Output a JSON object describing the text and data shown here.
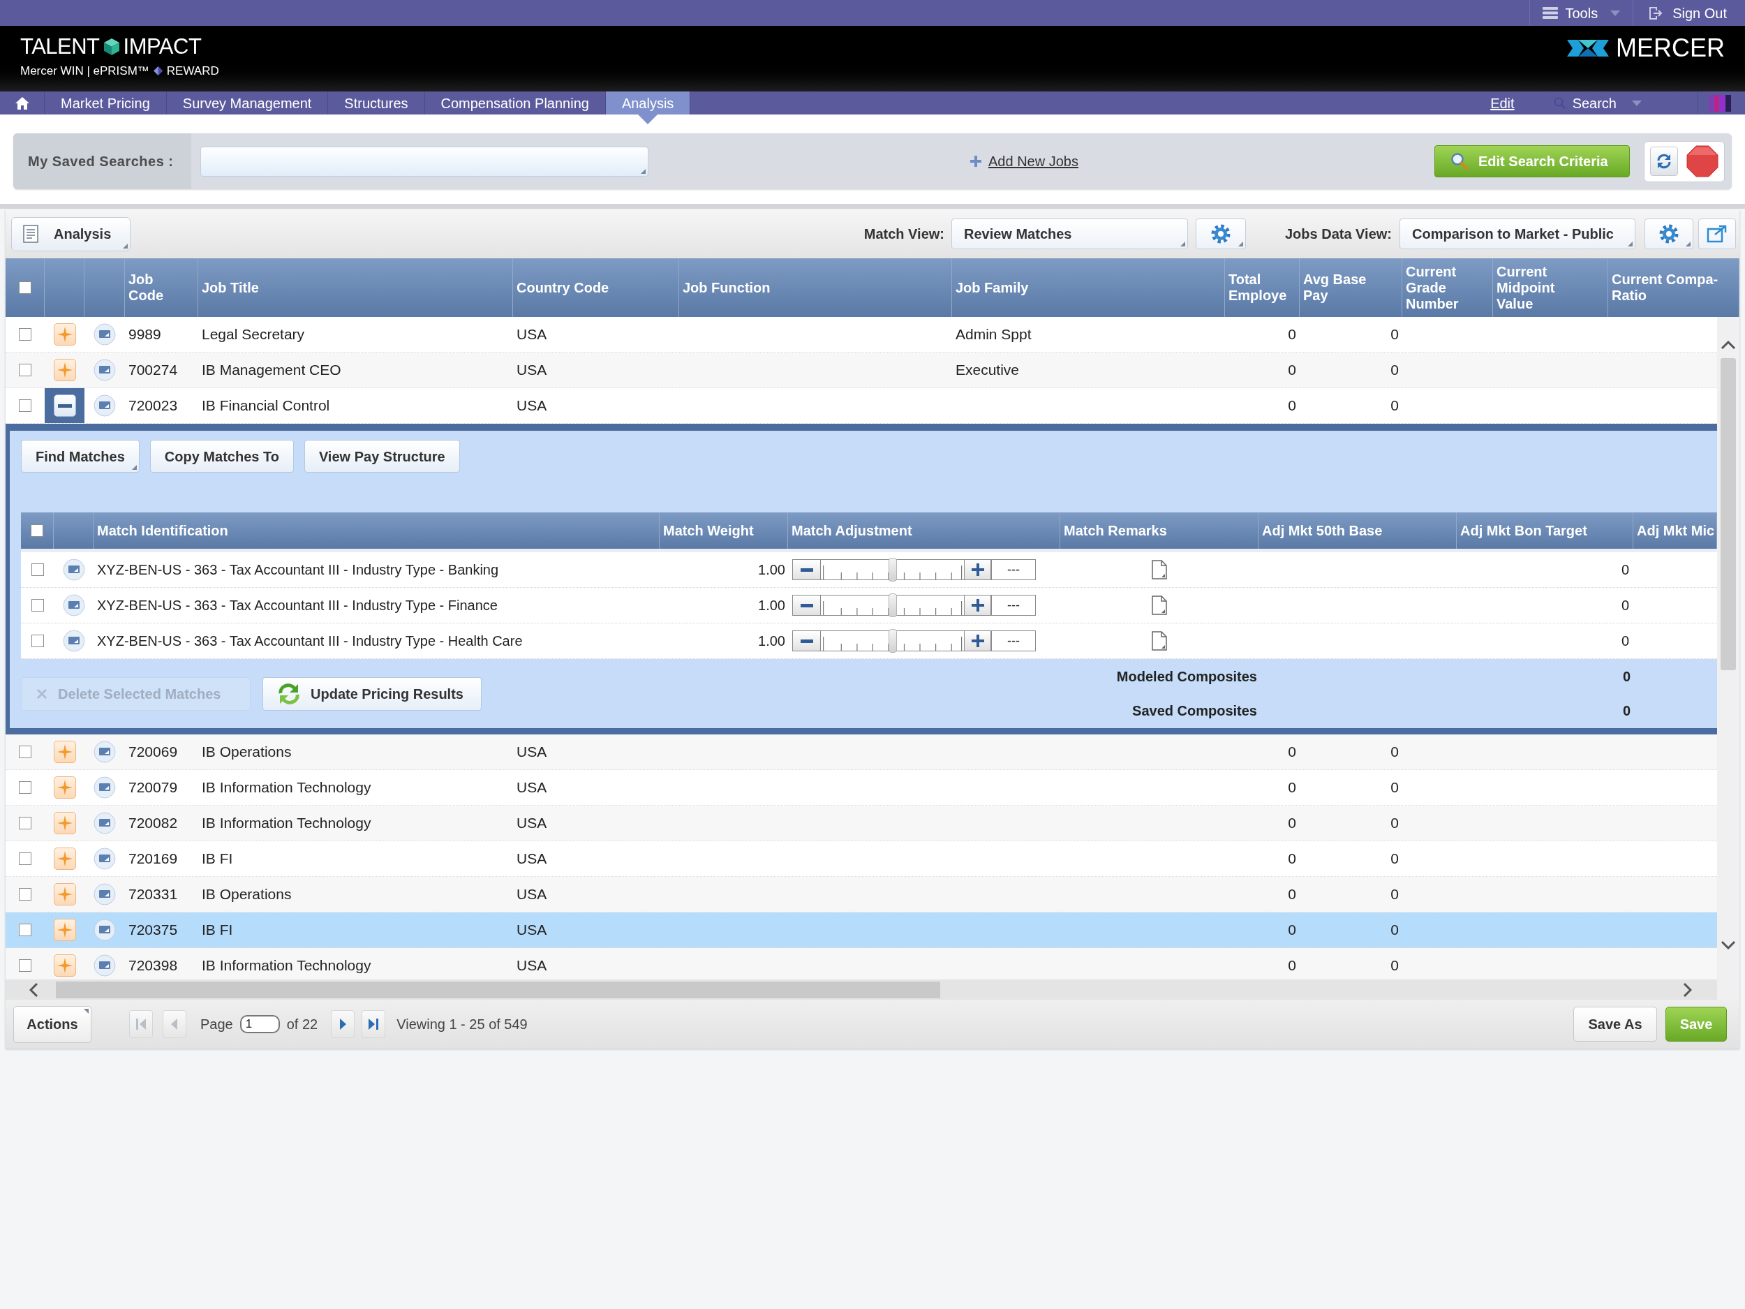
{
  "top_bar": {
    "tools": "Tools",
    "sign_out": "Sign Out"
  },
  "header": {
    "product": [
      "TALENT",
      "IMPACT"
    ],
    "modules": [
      "Mercer WIN | ePRISM™",
      "REWARD"
    ],
    "brand": "MERCER"
  },
  "nav": {
    "tabs": [
      {
        "label": "Market Pricing",
        "selected": false
      },
      {
        "label": "Survey Management",
        "selected": false
      },
      {
        "label": "Structures",
        "selected": false
      },
      {
        "label": "Compensation Planning",
        "selected": false
      },
      {
        "label": "Analysis",
        "selected": true
      }
    ],
    "edit": "Edit",
    "search": "Search"
  },
  "saved_searches": {
    "label": "My Saved Searches :",
    "add_new_jobs": "Add New Jobs",
    "edit_search_criteria": "Edit Search Criteria"
  },
  "toolbar": {
    "analysis": "Analysis",
    "match_view": {
      "label": "Match View:",
      "value": "Review Matches"
    },
    "jobs_data_view": {
      "label": "Jobs Data View:",
      "value": "Comparison to Market - Public"
    }
  },
  "jobs_table": {
    "all_checked": false,
    "columns": [
      "Job Code",
      "Job Title",
      "Country Code",
      "Job Function",
      "Job Family",
      "Total Employe",
      "Avg Base Pay",
      "Current Grade Number",
      "Current Midpoint Value",
      "Current Compa-Ratio"
    ],
    "rows": [
      {
        "checked": false,
        "expanded": false,
        "selected": false,
        "job_code": "9989",
        "job_title": "Legal Secretary",
        "country_code": "USA",
        "job_family": "Admin Sppt",
        "total_employees": "0",
        "avg_base_pay": "0"
      },
      {
        "checked": false,
        "expanded": false,
        "selected": false,
        "job_code": "700274",
        "job_title": "IB Management CEO",
        "country_code": "USA",
        "job_family": "Executive",
        "total_employees": "0",
        "avg_base_pay": "0"
      },
      {
        "checked": false,
        "expanded": true,
        "selected": false,
        "job_code": "720023",
        "job_title": "IB Financial Control",
        "country_code": "USA",
        "total_employees": "0",
        "avg_base_pay": "0",
        "detail": {
          "buttons": [
            "Find Matches",
            "Copy Matches To",
            "View Pay Structure"
          ],
          "all_checked": false,
          "columns": [
            "Match Identification",
            "Match Weight",
            "Match Adjustment",
            "Match Remarks",
            "Adj Mkt 50th Base",
            "Adj Mkt Bon Target",
            "Adj Mkt Mic"
          ],
          "matches": [
            {
              "checked": false,
              "identification": "XYZ-BEN-US - 363 - Tax Accountant III - Industry Type - Banking",
              "weight": "1.00",
              "adjustment": {
                "level": 0.5,
                "value": "---"
              },
              "adj_mkt_bon_target": "0"
            },
            {
              "checked": false,
              "identification": "XYZ-BEN-US - 363 - Tax Accountant III - Industry Type - Finance",
              "weight": "1.00",
              "adjustment": {
                "level": 0.5,
                "value": "---"
              },
              "adj_mkt_bon_target": "0"
            },
            {
              "checked": false,
              "identification": "XYZ-BEN-US - 363 - Tax Accountant III - Industry Type - Health Care",
              "weight": "1.00",
              "adjustment": {
                "level": 0.5,
                "value": "---"
              },
              "adj_mkt_bon_target": "0"
            }
          ],
          "delete_button": {
            "label": "Delete Selected Matches",
            "disabled": true
          },
          "update_button": "Update Pricing Results",
          "summary": [
            {
              "label": "Modeled Composites",
              "value": "0"
            },
            {
              "label": "Saved Composites",
              "value": "0"
            }
          ]
        }
      },
      {
        "checked": false,
        "expanded": false,
        "selected": false,
        "job_code": "720069",
        "job_title": "IB Operations",
        "country_code": "USA",
        "total_employees": "0",
        "avg_base_pay": "0"
      },
      {
        "checked": false,
        "expanded": false,
        "selected": false,
        "job_code": "720079",
        "job_title": "IB Information Technology",
        "country_code": "USA",
        "total_employees": "0",
        "avg_base_pay": "0"
      },
      {
        "checked": false,
        "expanded": false,
        "selected": false,
        "job_code": "720082",
        "job_title": "IB Information Technology",
        "country_code": "USA",
        "total_employees": "0",
        "avg_base_pay": "0"
      },
      {
        "checked": false,
        "expanded": false,
        "selected": false,
        "job_code": "720169",
        "job_title": "IB FI",
        "country_code": "USA",
        "total_employees": "0",
        "avg_base_pay": "0"
      },
      {
        "checked": false,
        "expanded": false,
        "selected": false,
        "job_code": "720331",
        "job_title": "IB Operations",
        "country_code": "USA",
        "total_employees": "0",
        "avg_base_pay": "0"
      },
      {
        "checked": false,
        "expanded": false,
        "selected": true,
        "job_code": "720375",
        "job_title": "IB FI",
        "country_code": "USA",
        "total_employees": "0",
        "avg_base_pay": "0"
      },
      {
        "checked": false,
        "expanded": false,
        "selected": false,
        "job_code": "720398",
        "job_title": "IB Information Technology",
        "country_code": "USA",
        "total_employees": "0",
        "avg_base_pay": "0"
      }
    ]
  },
  "footer": {
    "actions": "Actions",
    "pager_buttons": [
      {
        "kind": "first",
        "disabled": true
      },
      {
        "kind": "prev",
        "disabled": true
      },
      {
        "kind": "next",
        "disabled": false
      },
      {
        "kind": "last",
        "disabled": false
      }
    ],
    "page_label": "Page",
    "page": "1",
    "page_total": "of 22",
    "viewing": "Viewing 1 - 25 of 549",
    "save_as": "Save As",
    "save": "Save"
  }
}
